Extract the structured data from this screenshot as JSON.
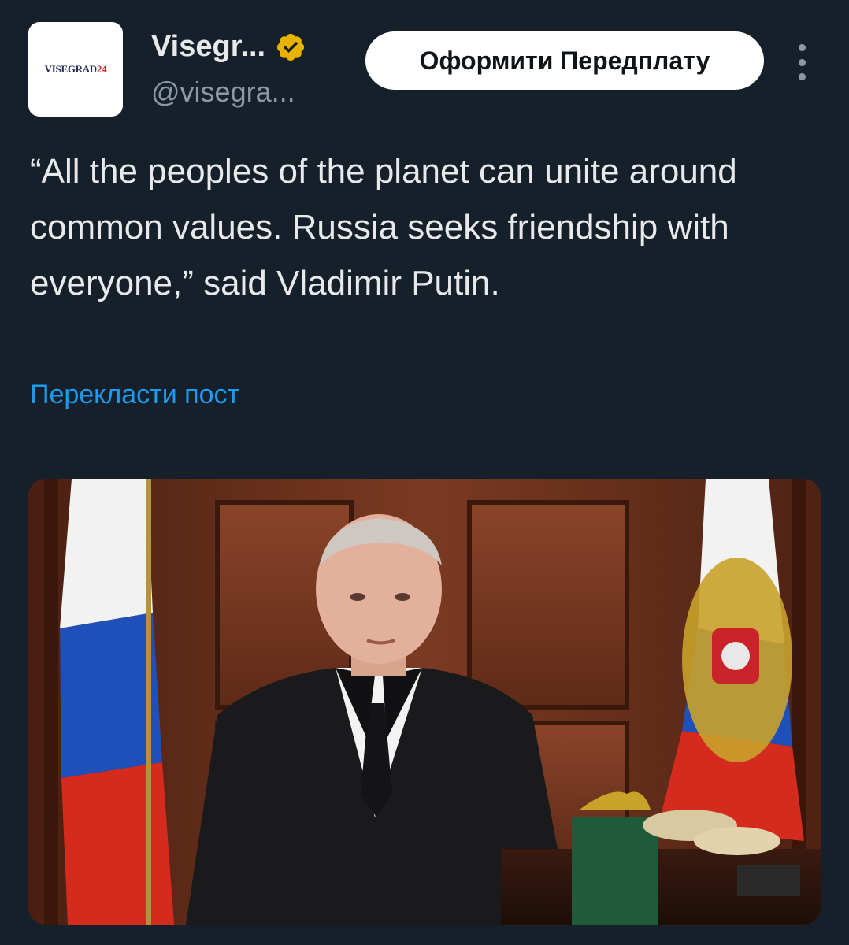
{
  "author": {
    "avatar_text": "VISEGRAD",
    "avatar_text_num": "24",
    "display_name": "Visegr...",
    "handle": "@visegra...",
    "verified": true,
    "verified_icon": "verified-badge-icon",
    "verified_color": "#e8b200"
  },
  "actions": {
    "subscribe_label": "Оформити Передплату",
    "more_icon": "more-vertical-icon"
  },
  "tweet": {
    "text": "“All the peoples of the planet can unite around common values. Russia seeks friendship with everyone,” said Vladimir Putin."
  },
  "translate_label": "Перекласти пост",
  "colors": {
    "background": "#15202b",
    "link": "#1d9bf0",
    "secondary_text": "#8b98a5"
  }
}
